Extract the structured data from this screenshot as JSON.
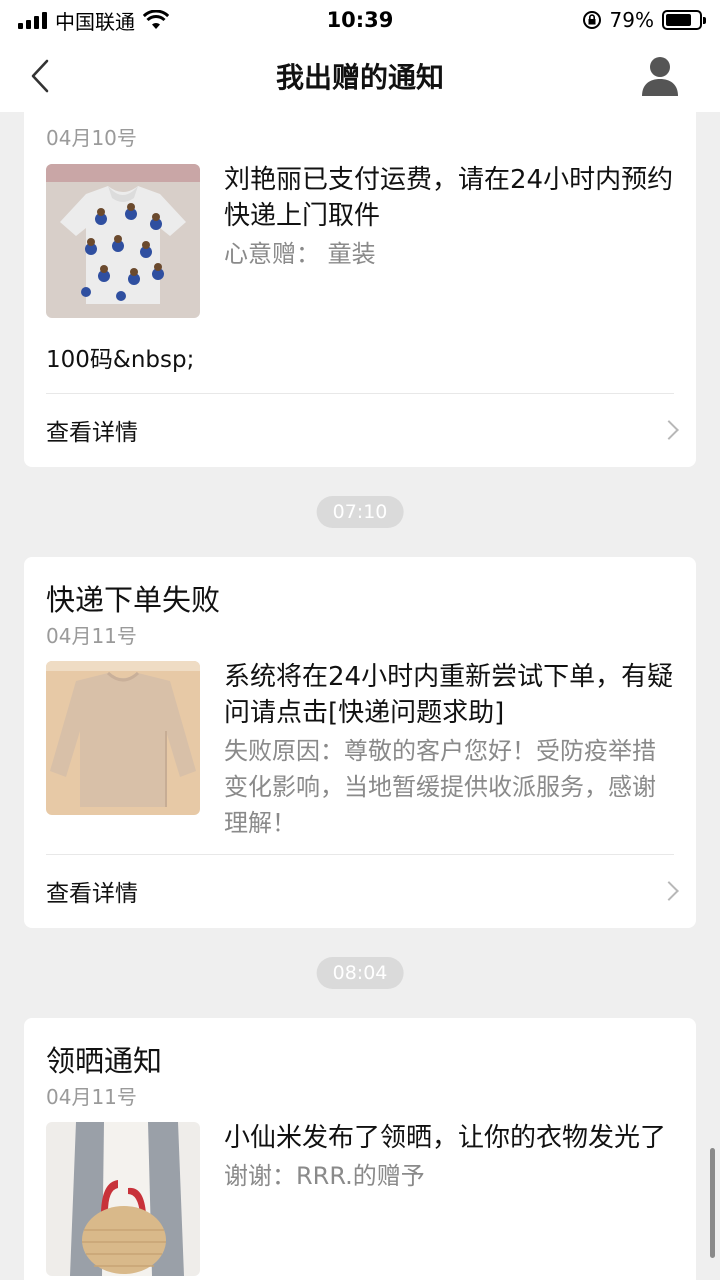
{
  "status_bar": {
    "carrier": "中国联通",
    "time": "10:39",
    "battery_percent": "79%",
    "battery_level": 0.79
  },
  "nav": {
    "title": "我出赠的通知"
  },
  "cards": [
    {
      "date": "04月10号",
      "message": "刘艳丽已支付运费，请在24小时内预约快递上门取件",
      "sub": "心意赠： 童装",
      "extra": "100码&nbsp;",
      "detail_label": "查看详情"
    },
    {
      "title": "快递下单失败",
      "date": "04月11号",
      "message": "系统将在24小时内重新尝试下单，有疑问请点击[快递问题求助]",
      "sub": "失败原因：尊敬的客户您好！受防疫举措变化影响，当地暂缓提供收派服务，感谢理解！",
      "detail_label": "查看详情"
    },
    {
      "title": "领晒通知",
      "date": "04月11号",
      "message": "小仙米发布了领晒，让你的衣物发光了",
      "sub": "谢谢：RRR.的赠予"
    }
  ],
  "time_separators": [
    "07:10",
    "08:04"
  ],
  "icons": {
    "back": "chevron-left-icon",
    "user": "user-profile-icon",
    "signal": "cellular-signal-icon",
    "wifi": "wifi-icon",
    "rotation_lock": "rotation-lock-icon",
    "battery": "battery-icon"
  }
}
